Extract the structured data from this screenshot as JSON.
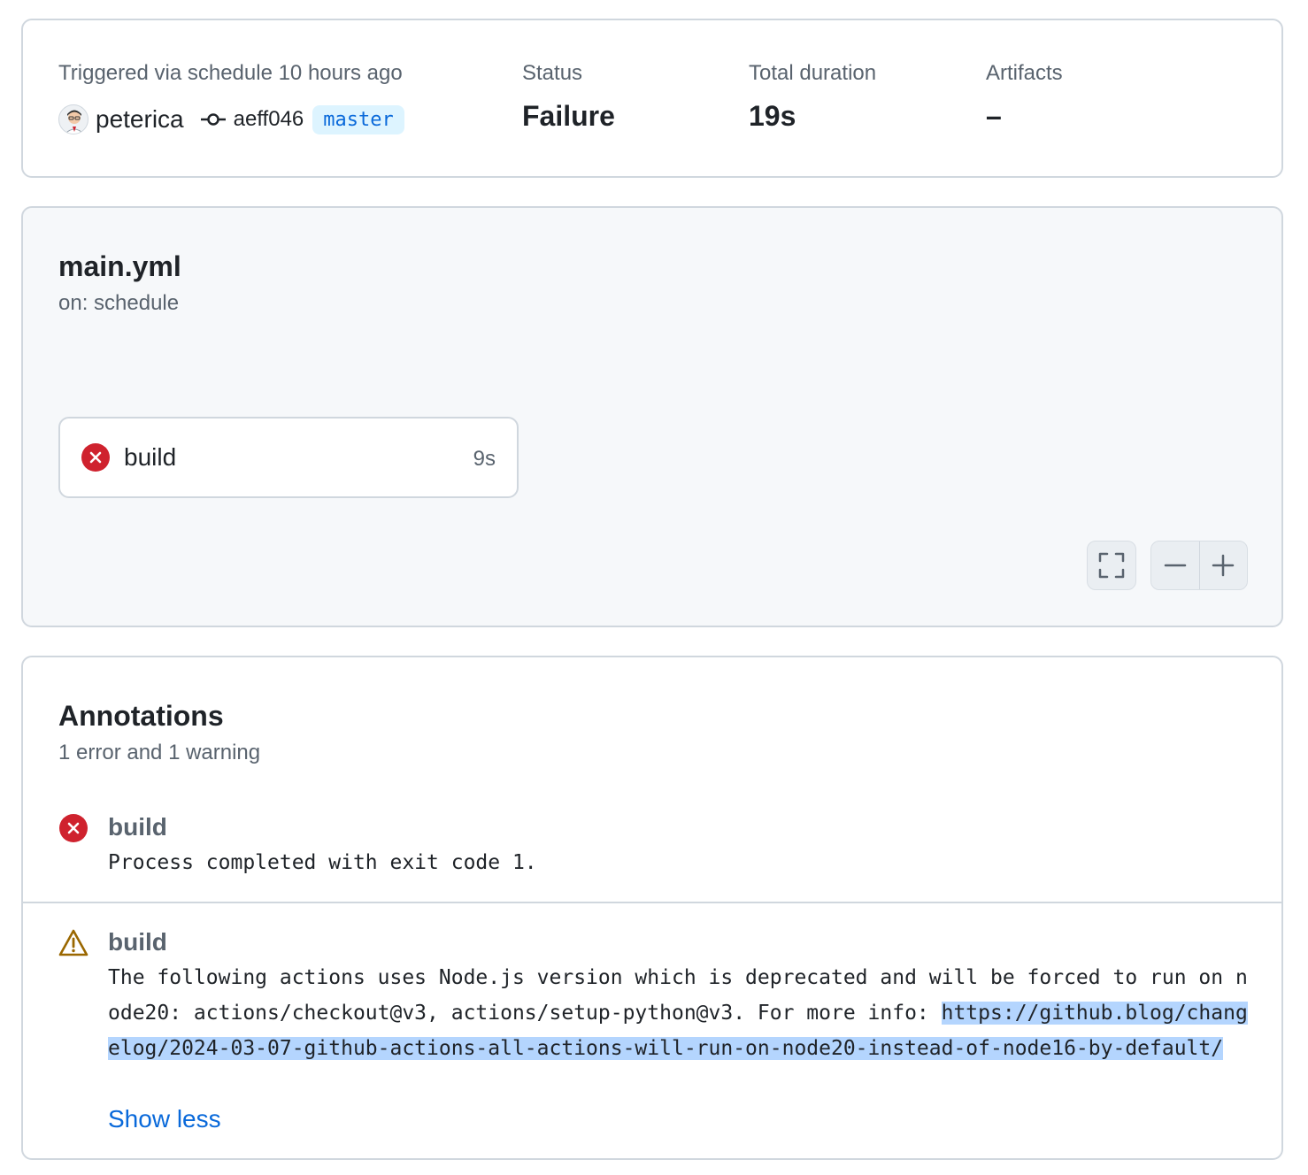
{
  "summary": {
    "trigger_label": "Triggered via schedule 10 hours ago",
    "actor": "peterica",
    "commit_sha": "aeff046",
    "branch": "master",
    "status_label": "Status",
    "status_value": "Failure",
    "duration_label": "Total duration",
    "duration_value": "19s",
    "artifacts_label": "Artifacts",
    "artifacts_value": "–"
  },
  "graph": {
    "workflow_name": "main.yml",
    "trigger": "on: schedule",
    "jobs": [
      {
        "name": "build",
        "duration": "9s",
        "status": "failure"
      }
    ],
    "controls": {
      "fullscreen_icon": "fullscreen-icon",
      "zoom_out_icon": "minus-icon",
      "zoom_in_icon": "plus-icon"
    }
  },
  "annotations": {
    "title": "Annotations",
    "subtitle": "1 error and 1 warning",
    "items": [
      {
        "level": "error",
        "icon": "x-circle-fill-icon",
        "job": "build",
        "message": "Process completed with exit code 1."
      },
      {
        "level": "warning",
        "icon": "alert-triangle-icon",
        "job": "build",
        "message": "The following actions uses Node.js version which is deprecated and will be forced to run on node20: actions/checkout@v3, actions/setup-python@v3. For more info: ",
        "link": "https://github.blog/changelog/2024-03-07-github-actions-all-actions-will-run-on-node20-instead-of-node16-by-default/",
        "toggle_label": "Show less"
      }
    ]
  },
  "colors": {
    "danger": "#cf222e",
    "attention": "#9a6700",
    "accent": "#0969da",
    "link_highlight": "#b4d5fe",
    "branch_bg": "#ddf4ff"
  }
}
